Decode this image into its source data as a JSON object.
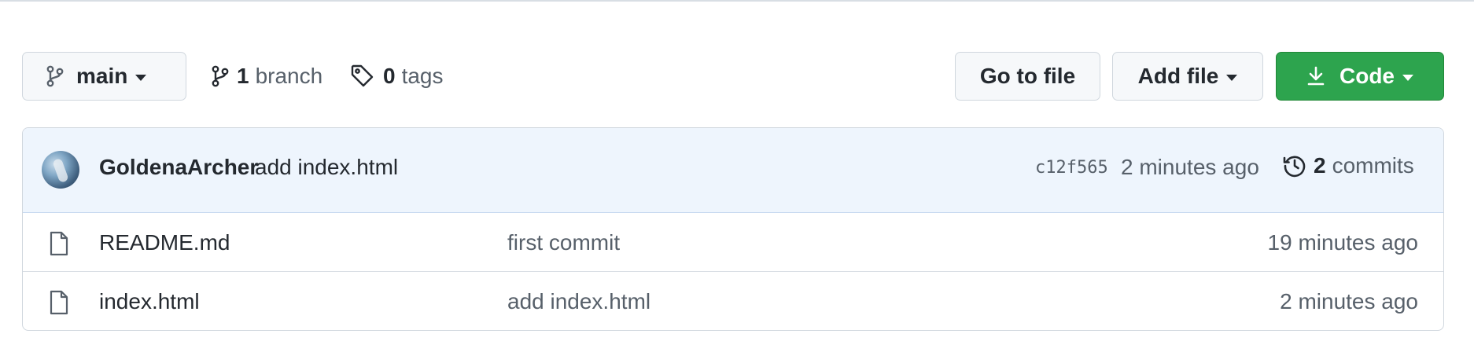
{
  "toolbar": {
    "branch_button": {
      "label": "main",
      "icon": "git-branch-icon"
    },
    "branches_link": {
      "count": "1",
      "label": "branch",
      "icon": "git-branch-icon"
    },
    "tags_link": {
      "count": "0",
      "label": "tags",
      "icon": "tag-icon"
    },
    "go_to_file_label": "Go to file",
    "add_file_label": "Add file",
    "code_button": {
      "label": "Code",
      "icon": "download-icon",
      "color": "#2da44e"
    }
  },
  "latest_commit": {
    "author": "GoldenaArcher",
    "message": "add index.html",
    "sha": "c12f565",
    "time": "2 minutes ago",
    "commits_count": "2",
    "commits_label": "commits",
    "history_icon": "history-icon",
    "background": "#eef5fd"
  },
  "files": [
    {
      "icon": "file-icon",
      "name": "README.md",
      "message": "first commit",
      "time": "19 minutes ago"
    },
    {
      "icon": "file-icon",
      "name": "index.html",
      "message": "add index.html",
      "time": "2 minutes ago"
    }
  ]
}
